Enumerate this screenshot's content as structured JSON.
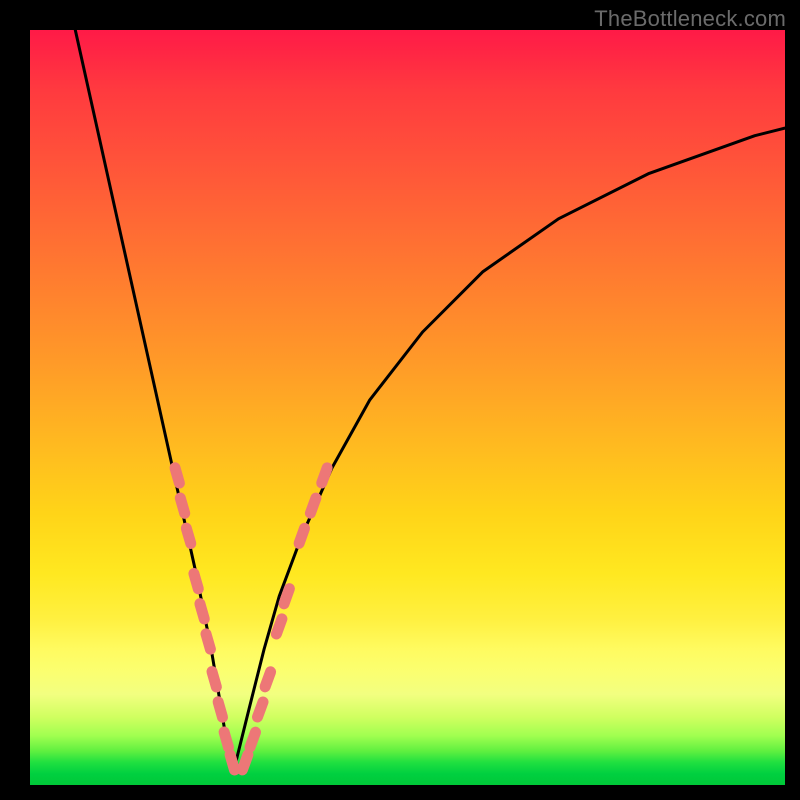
{
  "watermark": {
    "text": "TheBottleneck.com"
  },
  "colors": {
    "gradient_top": "#ff1a47",
    "gradient_mid1": "#ff9a28",
    "gradient_mid2": "#ffe820",
    "gradient_bottom": "#00c838",
    "curve": "#000000",
    "marker": "#ed7777",
    "frame": "#000000"
  },
  "chart_data": {
    "type": "line",
    "title": "",
    "xlabel": "",
    "ylabel": "",
    "xlim": [
      0,
      100
    ],
    "ylim": [
      0,
      100
    ],
    "grid": false,
    "note": "Values are estimated from the image; x and y are in percent of plot width/height with y=0 at bottom. The two curves form a V shape meeting near x≈27, y≈2.",
    "series": [
      {
        "name": "left-branch",
        "x": [
          6,
          8,
          10,
          12,
          14,
          16,
          18,
          20,
          22,
          24,
          25,
          26,
          27
        ],
        "y": [
          100,
          91,
          82,
          73,
          64,
          55,
          46,
          37,
          28,
          18,
          12,
          6,
          2
        ]
      },
      {
        "name": "right-branch",
        "x": [
          27,
          29,
          31,
          33,
          36,
          40,
          45,
          52,
          60,
          70,
          82,
          96,
          100
        ],
        "y": [
          2,
          10,
          18,
          25,
          33,
          42,
          51,
          60,
          68,
          75,
          81,
          86,
          87
        ]
      }
    ],
    "markers": {
      "comment": "Pink capsule-shaped markers clustered on lower portions of both branches.",
      "points": [
        {
          "branch": "left",
          "x": 19.5,
          "y": 41
        },
        {
          "branch": "left",
          "x": 20.2,
          "y": 37
        },
        {
          "branch": "left",
          "x": 21.0,
          "y": 33
        },
        {
          "branch": "left",
          "x": 22.0,
          "y": 27
        },
        {
          "branch": "left",
          "x": 22.8,
          "y": 23
        },
        {
          "branch": "left",
          "x": 23.6,
          "y": 19
        },
        {
          "branch": "left",
          "x": 24.4,
          "y": 14
        },
        {
          "branch": "left",
          "x": 25.2,
          "y": 10
        },
        {
          "branch": "left",
          "x": 26.0,
          "y": 6
        },
        {
          "branch": "left",
          "x": 26.8,
          "y": 3
        },
        {
          "branch": "right",
          "x": 28.5,
          "y": 3
        },
        {
          "branch": "right",
          "x": 29.5,
          "y": 6
        },
        {
          "branch": "right",
          "x": 30.5,
          "y": 10
        },
        {
          "branch": "right",
          "x": 31.5,
          "y": 14
        },
        {
          "branch": "right",
          "x": 33.0,
          "y": 21
        },
        {
          "branch": "right",
          "x": 34.0,
          "y": 25
        },
        {
          "branch": "right",
          "x": 36.0,
          "y": 33
        },
        {
          "branch": "right",
          "x": 37.5,
          "y": 37
        },
        {
          "branch": "right",
          "x": 39.0,
          "y": 41
        }
      ]
    }
  }
}
